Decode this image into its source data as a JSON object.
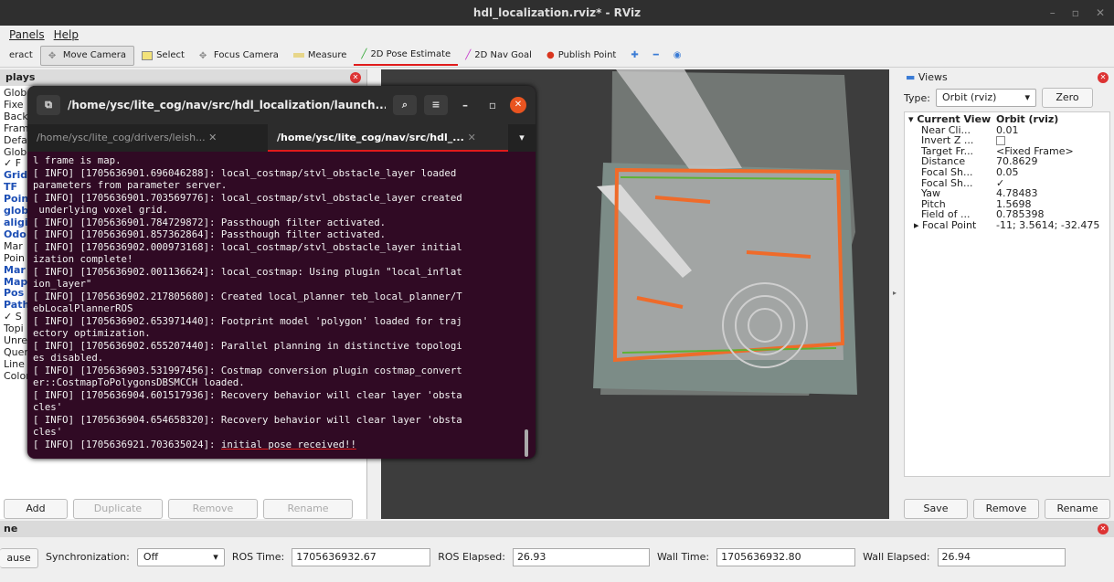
{
  "window": {
    "title": "hdl_localization.rviz* - RViz"
  },
  "menu": [
    "Panels",
    "Help"
  ],
  "toolbar": [
    "eract",
    "Move Camera",
    "Select",
    "Focus Camera",
    "Measure",
    "2D Pose Estimate",
    "2D Nav Goal",
    "Publish Point"
  ],
  "displays": {
    "title": "plays",
    "items": [
      "Glob",
      "Fixe",
      "Back",
      "Fram",
      "Defa",
      "Glob",
      "✓ F",
      "Grid",
      "TF",
      "Poin",
      "glob",
      "aligi",
      "Odo",
      "Mar",
      "Poin",
      "Mar",
      "Map",
      "Pos",
      "Path",
      "✓ S",
      "Topi",
      "Unre",
      "Quer",
      "Line",
      "Color"
    ],
    "buttons": {
      "add": "Add",
      "duplicate": "Duplicate",
      "remove": "Remove",
      "rename": "Rename"
    }
  },
  "terminal": {
    "title": "/home/ysc/lite_cog/nav/src/hdl_localization/launch...",
    "tabs": [
      "/home/ysc/lite_cog/drivers/leish...",
      "/home/ysc/lite_cog/nav/src/hdl_..."
    ],
    "lines": [
      "l frame is map.",
      "[ INFO] [1705636901.696046288]: local_costmap/stvl_obstacle_layer loaded",
      "parameters from parameter server.",
      "[ INFO] [1705636901.703569776]: local_costmap/stvl_obstacle_layer created",
      " underlying voxel grid.",
      "[ INFO] [1705636901.784729872]: Passthough filter activated.",
      "[ INFO] [1705636901.857362864]: Passthough filter activated.",
      "[ INFO] [1705636902.000973168]: local_costmap/stvl_obstacle_layer initial",
      "ization complete!",
      "[ INFO] [1705636902.001136624]: local_costmap: Using plugin \"local_inflat",
      "ion_layer\"",
      "[ INFO] [1705636902.217805680]: Created local_planner teb_local_planner/T",
      "ebLocalPlannerROS",
      "[ INFO] [1705636902.653971440]: Footprint model 'polygon' loaded for traj",
      "ectory optimization.",
      "[ INFO] [1705636902.655207440]: Parallel planning in distinctive topologi",
      "es disabled.",
      "[ INFO] [1705636903.531997456]: Costmap conversion plugin costmap_convert",
      "er::CostmapToPolygonsDBSMCCH loaded.",
      "[ INFO] [1705636904.601517936]: Recovery behavior will clear layer 'obsta",
      "cles'",
      "[ INFO] [1705636904.654658320]: Recovery behavior will clear layer 'obsta",
      "cles'"
    ],
    "last_prefix": "[ INFO] [1705636921.703635024]: ",
    "last_highlight": "initial pose received!!"
  },
  "views": {
    "title": "Views",
    "type_label": "Type:",
    "type_value": "Orbit (rviz)",
    "zero": "Zero",
    "tree": [
      [
        "▾ Current View",
        "Orbit (rviz)"
      ],
      [
        "Near Cli...",
        "0.01"
      ],
      [
        "Invert Z ...",
        ""
      ],
      [
        "Target Fr...",
        "<Fixed Frame>"
      ],
      [
        "Distance",
        "70.8629"
      ],
      [
        "Focal Sh...",
        "0.05"
      ],
      [
        "Focal Sh...",
        "✓"
      ],
      [
        "Yaw",
        "4.78483"
      ],
      [
        "Pitch",
        "1.5698"
      ],
      [
        "Field of ...",
        "0.785398"
      ],
      [
        "▸ Focal Point",
        "-11; 3.5614; -32.475"
      ]
    ],
    "buttons": {
      "save": "Save",
      "remove": "Remove",
      "rename": "Rename"
    }
  },
  "time": {
    "header": "ne",
    "pause": "ause",
    "sync_label": "Synchronization:",
    "sync_value": "Off",
    "ros_time_label": "ROS Time:",
    "ros_time": "1705636932.67",
    "ros_elapsed_label": "ROS Elapsed:",
    "ros_elapsed": "26.93",
    "wall_time_label": "Wall Time:",
    "wall_time": "1705636932.80",
    "wall_elapsed_label": "Wall Elapsed:",
    "wall_elapsed": "26.94"
  }
}
